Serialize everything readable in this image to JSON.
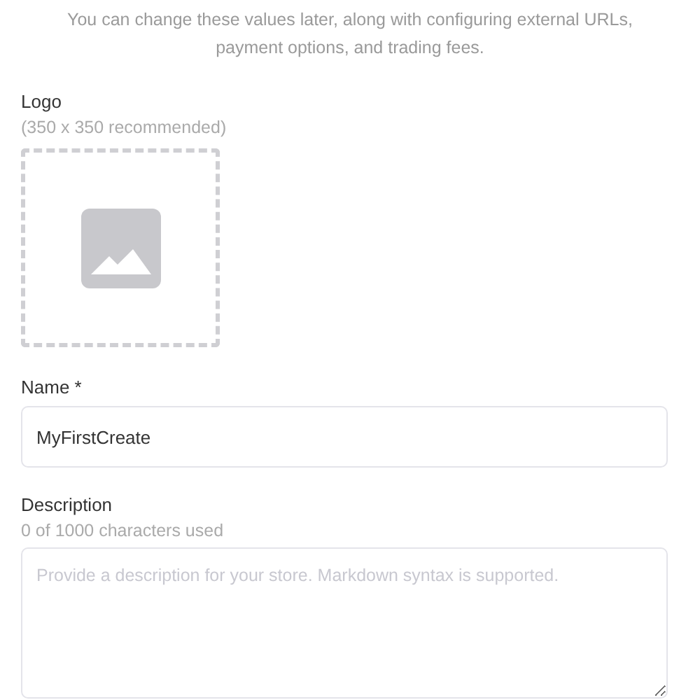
{
  "intro": "You can change these values later, along with configuring external URLs, payment options, and trading fees.",
  "logo": {
    "label": "Logo",
    "hint": "(350 x 350 recommended)"
  },
  "name_field": {
    "label": "Name *",
    "value": "MyFirstCreate"
  },
  "description_field": {
    "label": "Description",
    "hint": "0 of 1000 characters used",
    "placeholder": "Provide a description for your store. Markdown syntax is supported."
  }
}
